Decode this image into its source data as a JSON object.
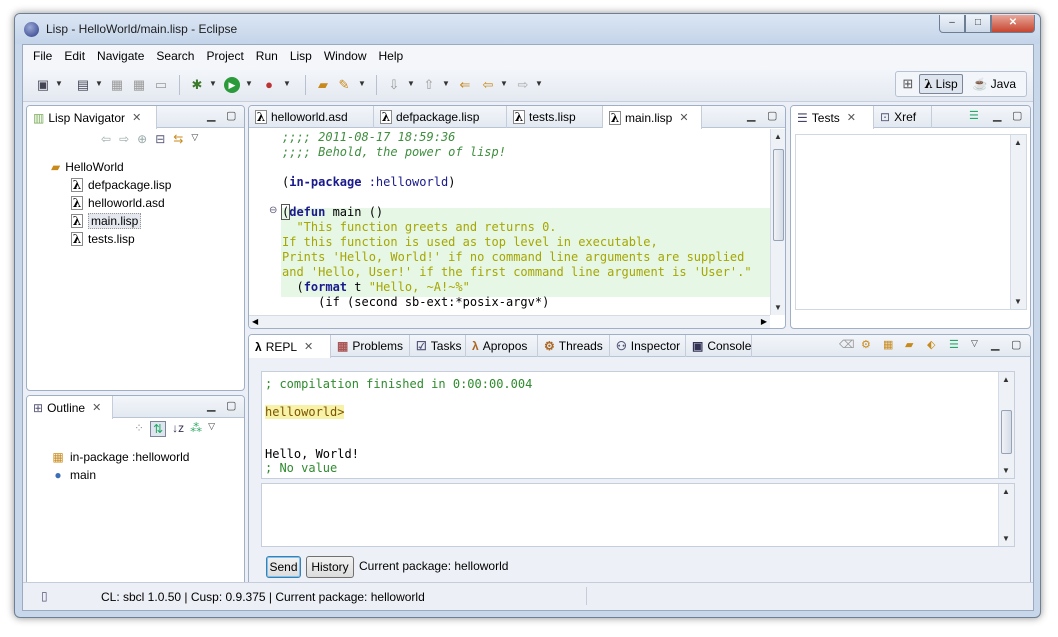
{
  "window": {
    "title": "Lisp - HelloWorld/main.lisp - Eclipse",
    "controls": {
      "minimize": "–",
      "maximize": "□",
      "close": "✕"
    }
  },
  "menu": [
    "File",
    "Edit",
    "Navigate",
    "Search",
    "Project",
    "Run",
    "Lisp",
    "Window",
    "Help"
  ],
  "perspectives": [
    {
      "label": "Lisp",
      "icon": "lambda-icon",
      "glyph": "λ",
      "active": true
    },
    {
      "label": "Java",
      "icon": "java-icon",
      "glyph": "☕",
      "active": false
    }
  ],
  "navigator": {
    "tab_label": "Lisp Navigator",
    "project": "HelloWorld",
    "files": [
      {
        "name": "defpackage.lisp",
        "selected": false
      },
      {
        "name": "helloworld.asd",
        "selected": false
      },
      {
        "name": "main.lisp",
        "selected": true
      },
      {
        "name": "tests.lisp",
        "selected": false
      }
    ]
  },
  "outline": {
    "tab_label": "Outline",
    "items": [
      {
        "label": "in-package :helloworld",
        "icon": "package-icon"
      },
      {
        "label": "main",
        "icon": "function-icon"
      }
    ]
  },
  "editor": {
    "tabs": [
      {
        "label": "helloworld.asd",
        "active": false
      },
      {
        "label": "defpackage.lisp",
        "active": false
      },
      {
        "label": "tests.lisp",
        "active": false
      },
      {
        "label": "main.lisp",
        "active": true
      }
    ],
    "lines": [
      [
        {
          "t": ";;;; 2011-08-17 18:59:36",
          "c": "#3f8f3f",
          "i": true
        }
      ],
      [
        {
          "t": ";;;; Behold, the power of lisp!",
          "c": "#3f8f3f",
          "i": true
        }
      ],
      [],
      [
        {
          "t": "(",
          "c": "#000"
        },
        {
          "t": "in-package",
          "c": "#1a1a8c",
          "b": true
        },
        {
          "t": " :helloworld",
          "c": "#1a1a8c"
        },
        {
          "t": ")",
          "c": "#000"
        }
      ],
      [],
      [
        {
          "t": "(",
          "c": "#000",
          "box": true
        },
        {
          "t": "defun",
          "c": "#1a1a8c",
          "b": true
        },
        {
          "t": " main ()",
          "c": "#000"
        }
      ],
      [
        {
          "t": "  \"This function greets and returns 0.",
          "c": "#a6a600"
        }
      ],
      [
        {
          "t": "If this function is used as top level in executable,",
          "c": "#a6a600"
        }
      ],
      [
        {
          "t": "Prints 'Hello, World!' if no command line arguments are supplied",
          "c": "#a6a600"
        }
      ],
      [
        {
          "t": "and 'Hello, User!' if the first command line argument is 'User'.\"",
          "c": "#a6a600"
        }
      ],
      [
        {
          "t": "  (",
          "c": "#000"
        },
        {
          "t": "format",
          "c": "#1a1a8c",
          "b": true
        },
        {
          "t": " t ",
          "c": "#000"
        },
        {
          "t": "\"Hello, ~A!~%\"",
          "c": "#a6a600"
        }
      ],
      [
        {
          "t": "     (if (second sb-ext:*posix-argv*)",
          "c": "#000"
        }
      ]
    ]
  },
  "tests_panel": {
    "tabs": [
      "Tests",
      "Xref"
    ]
  },
  "bottom_tabs": [
    "REPL",
    "Problems",
    "Tasks",
    "Apropos",
    "Threads",
    "Inspector",
    "Console"
  ],
  "repl": {
    "output": [
      {
        "t": "; compilation finished in 0:00:00.004",
        "c": "#2e8b2e"
      },
      {
        "t": "",
        "c": "#000"
      },
      {
        "t": "helloworld>",
        "c": "#7a5500",
        "prompt": true
      },
      {
        "t": "",
        "c": "#000"
      },
      {
        "t": "",
        "c": "#000"
      },
      {
        "t": "Hello, World!",
        "c": "#000"
      },
      {
        "t": "; No value",
        "c": "#2e8b2e"
      }
    ],
    "send_label": "Send",
    "history_label": "History",
    "current_package": "Current package: helloworld"
  },
  "status": {
    "text": "CL: sbcl 1.0.50 | Cusp: 0.9.375 | Current package: helloworld"
  }
}
